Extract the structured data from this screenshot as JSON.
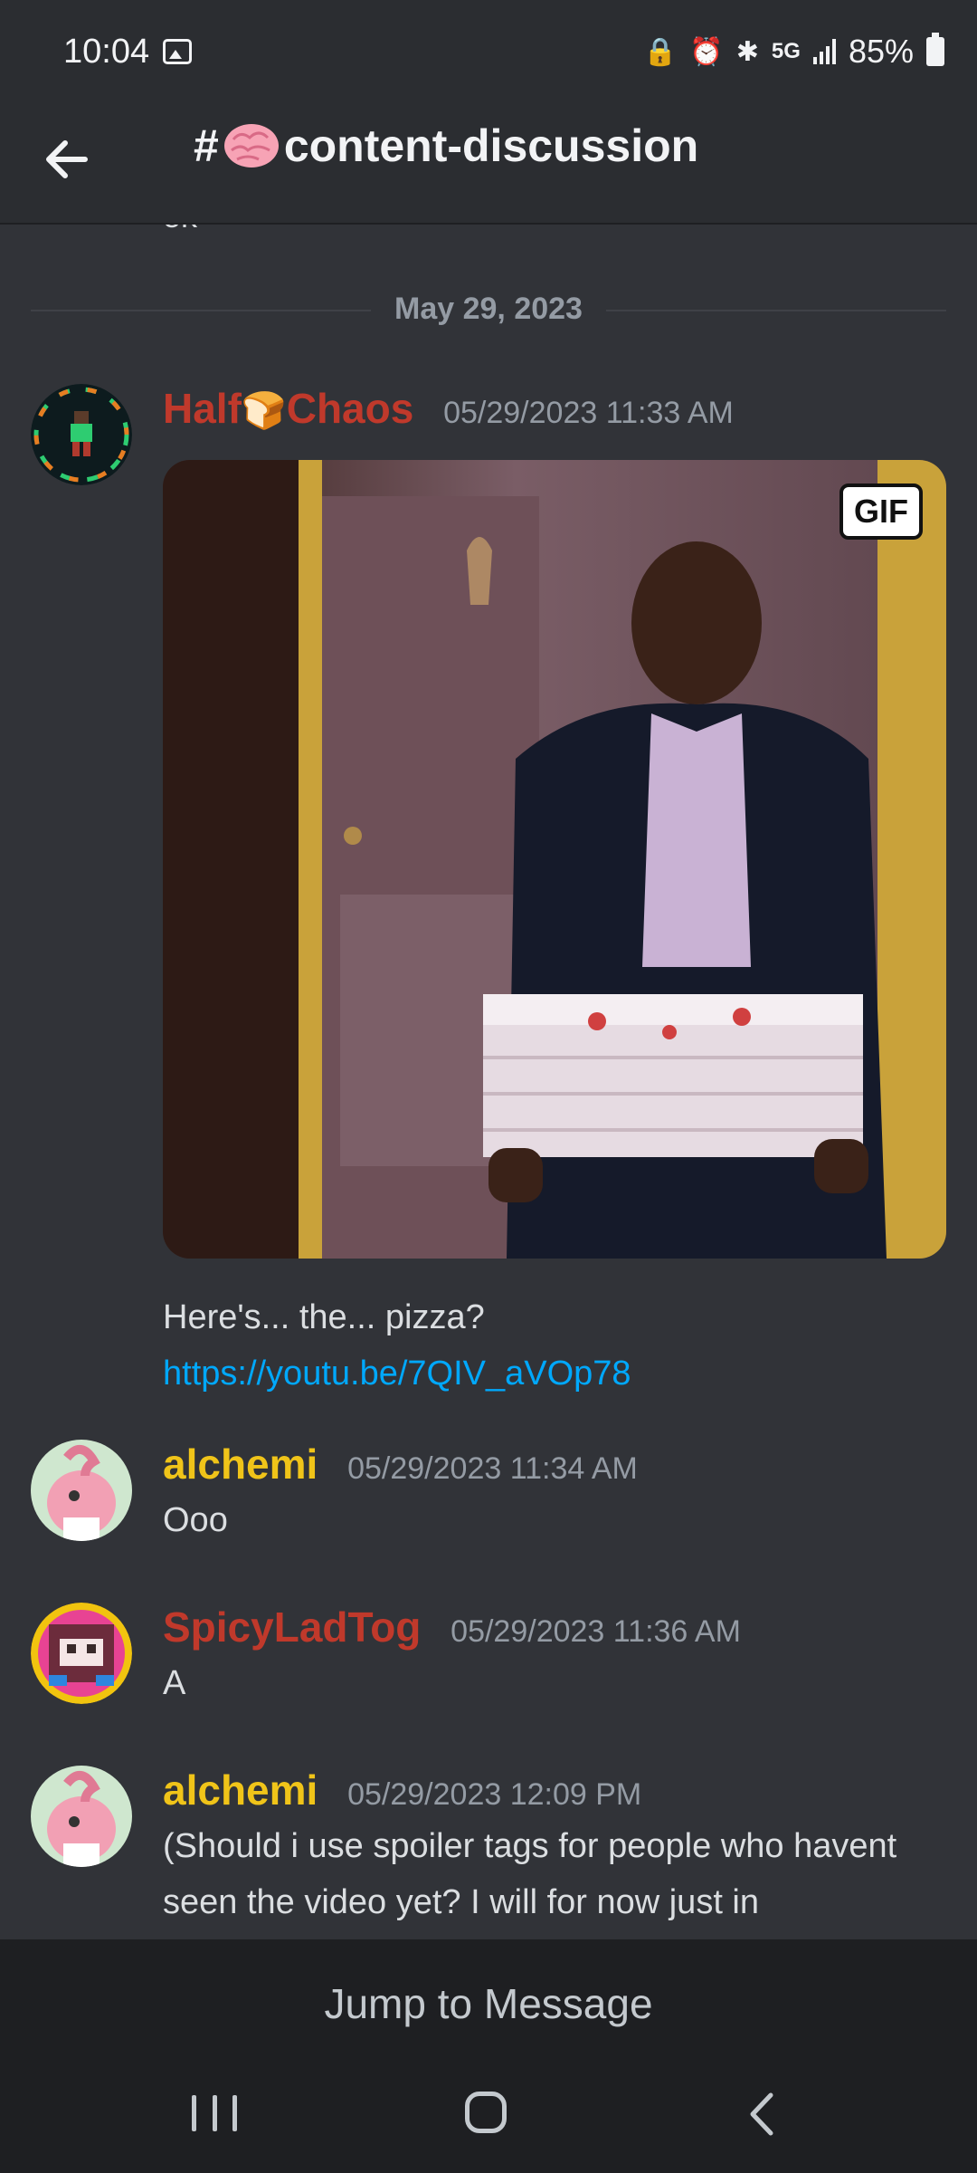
{
  "status_bar": {
    "time": "10:04",
    "battery": "85%",
    "network": "5G"
  },
  "header": {
    "hash": "#",
    "channel_name": "content-discussion"
  },
  "content": {
    "clipped_prev_text": "ok",
    "date_divider": "May 29, 2023",
    "messages": [
      {
        "author_prefix": "Half",
        "author_suffix": "Chaos",
        "author_color": "#c0392b",
        "timestamp": "05/29/2023 11:33 AM",
        "gif_badge": "GIF",
        "text": "Here's... the... pizza?",
        "link": "https://youtu.be/7QIV_aVOp78"
      },
      {
        "author": "alchemi",
        "author_color": "#f0c419",
        "timestamp": "05/29/2023 11:34 AM",
        "text": "Ooo"
      },
      {
        "author": "SpicyLadTog",
        "author_color": "#c0392b",
        "timestamp": "05/29/2023 11:36 AM",
        "text": "A"
      },
      {
        "author": "alchemi",
        "author_color": "#f0c419",
        "timestamp": "05/29/2023 12:09 PM",
        "text": "(Should i use spoiler tags for people who havent seen the video yet? I will for now just in"
      }
    ]
  },
  "jump_bar": {
    "label": "Jump to Message"
  },
  "icons": {
    "back": "arrow-left-icon",
    "brain": "brain-emoji",
    "bread": "bread-emoji"
  }
}
